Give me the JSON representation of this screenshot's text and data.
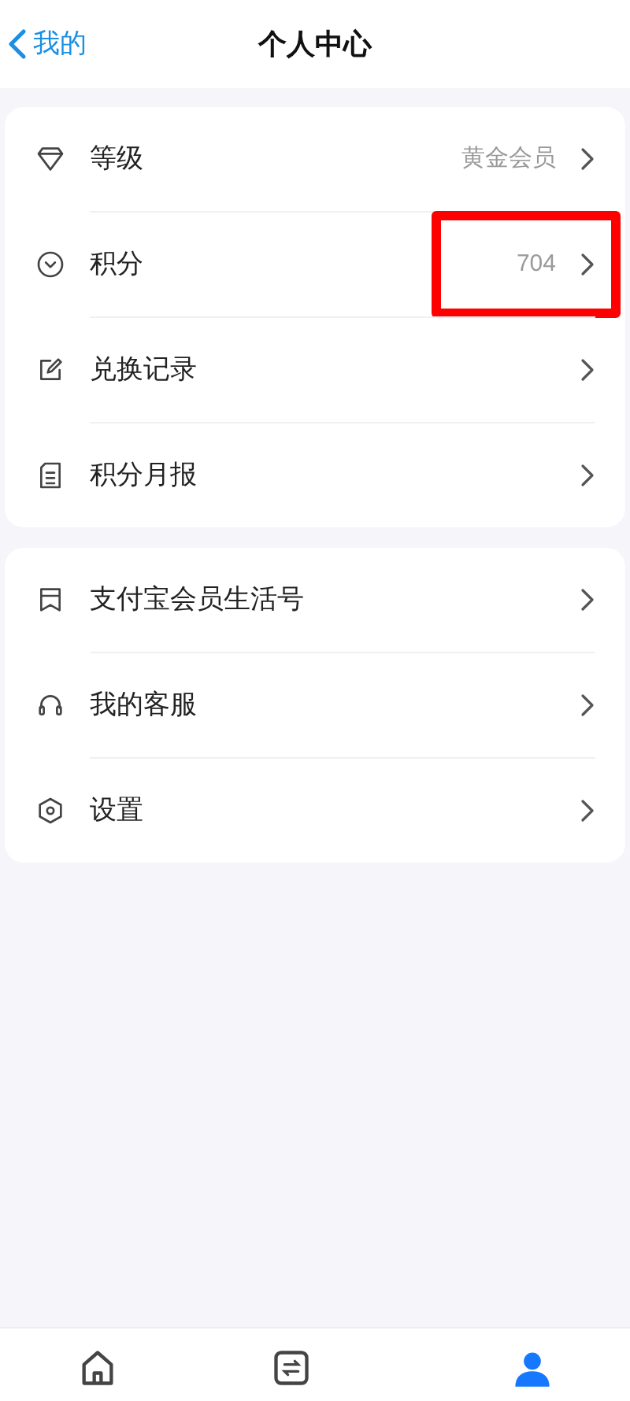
{
  "header": {
    "back_label": "我的",
    "title": "个人中心"
  },
  "groups": [
    {
      "items": [
        {
          "kind": "diamond",
          "label": "等级",
          "value": "黄金会员",
          "highlighted": false
        },
        {
          "kind": "chevron-circle",
          "label": "积分",
          "value": "704",
          "highlighted": true
        },
        {
          "kind": "edit",
          "label": "兑换记录",
          "highlighted": false
        },
        {
          "kind": "document",
          "label": "积分月报",
          "highlighted": false
        }
      ]
    },
    {
      "items": [
        {
          "kind": "bookmark",
          "label": "支付宝会员生活号",
          "highlighted": false
        },
        {
          "kind": "headset",
          "label": "我的客服",
          "highlighted": false
        },
        {
          "kind": "hexagon",
          "label": "设置",
          "highlighted": false
        }
      ]
    }
  ],
  "tab_bar": [
    {
      "kind": "home",
      "selected": false
    },
    {
      "kind": "exchange",
      "selected": false
    },
    {
      "kind": "person",
      "selected": true
    }
  ]
}
